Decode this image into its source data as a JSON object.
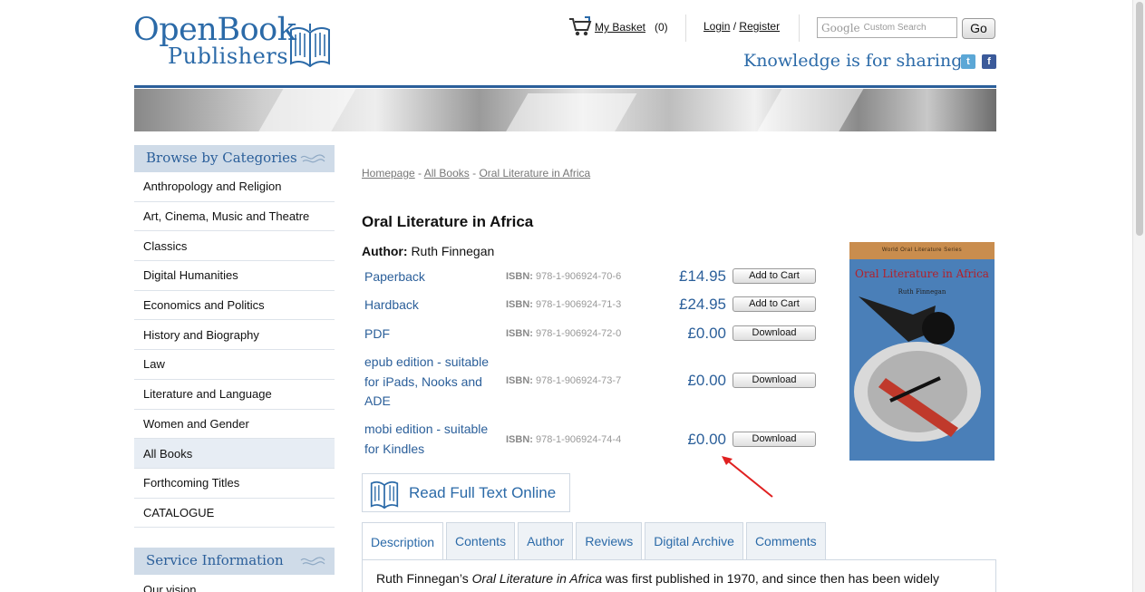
{
  "header": {
    "logo_line1": "OpenBook",
    "logo_line2": "Publishers",
    "basket_label": "My Basket",
    "basket_count": "(0)",
    "login_label": "Login",
    "login_sep": "/",
    "register_label": "Register",
    "search_brand": "Google",
    "search_placeholder": "Custom Search",
    "go_label": "Go",
    "tagline": "Knowledge is for sharing.",
    "twitter_glyph": "t",
    "facebook_glyph": "f"
  },
  "sidebar": {
    "browse_title": "Browse by Categories",
    "categories": [
      {
        "label": "Anthropology and Religion"
      },
      {
        "label": "Art, Cinema, Music and Theatre"
      },
      {
        "label": "Classics"
      },
      {
        "label": "Digital Humanities"
      },
      {
        "label": "Economics and Politics"
      },
      {
        "label": "History and Biography"
      },
      {
        "label": "Law"
      },
      {
        "label": "Literature and Language"
      },
      {
        "label": "Women and Gender"
      },
      {
        "label": "All Books"
      },
      {
        "label": "Forthcoming Titles"
      },
      {
        "label": "CATALOGUE"
      }
    ],
    "service_title": "Service Information",
    "service_items": [
      {
        "label": "Our vision"
      }
    ]
  },
  "breadcrumb": {
    "items": [
      "Homepage",
      "All Books",
      "Oral Literature in Africa"
    ],
    "separator": " - "
  },
  "book": {
    "title": "Oral Literature in Africa",
    "author_label": "Author:",
    "author": "Ruth Finnegan",
    "isbn_label": "ISBN:",
    "formats": [
      {
        "name": "Paperback",
        "isbn": "978-1-906924-70-6",
        "price": "£14.95",
        "button": "Add to Cart"
      },
      {
        "name": "Hardback",
        "isbn": "978-1-906924-71-3",
        "price": "£24.95",
        "button": "Add to Cart"
      },
      {
        "name": "PDF",
        "isbn": "978-1-906924-72-0",
        "price": "£0.00",
        "button": "Download"
      },
      {
        "name": "epub edition - suitable for iPads, Nooks and ADE",
        "isbn": "978-1-906924-73-7",
        "price": "£0.00",
        "button": "Download"
      },
      {
        "name": "mobi edition - suitable for Kindles",
        "isbn": "978-1-906924-74-4",
        "price": "£0.00",
        "button": "Download"
      }
    ],
    "cover": {
      "series": "World Oral Literature Series",
      "title": "Oral Literature in Africa",
      "author": "Ruth Finnegan"
    },
    "read_online_label": "Read Full Text Online"
  },
  "tabs": [
    "Description",
    "Contents",
    "Author",
    "Reviews",
    "Digital Archive",
    "Comments"
  ],
  "description": {
    "prefix": "Ruth Finnegan’s ",
    "title_italic": "Oral Literature in Africa",
    "suffix": " was first published in 1970, and since then has been widely"
  },
  "colors": {
    "brand": "#2b6aa8",
    "sidebar_header": "#cfdbe8",
    "annotation_arrow": "#e02020"
  }
}
